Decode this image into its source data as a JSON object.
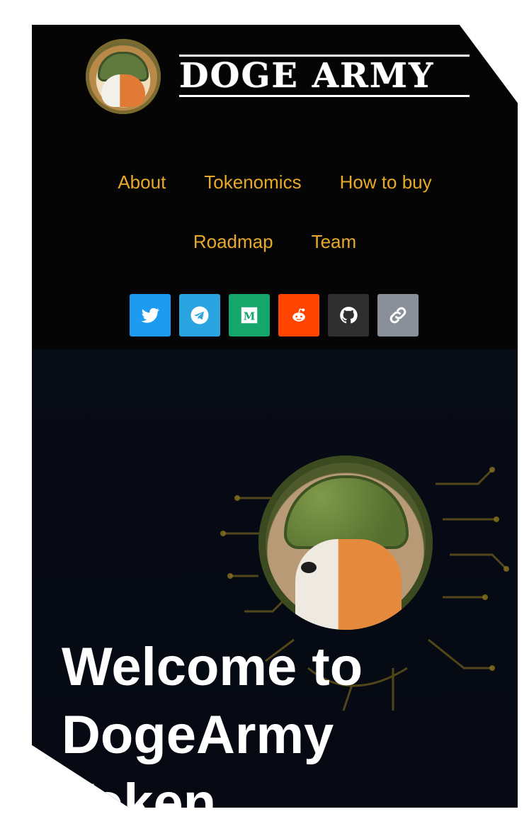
{
  "brand": {
    "logo_text": "DOGE ARMY"
  },
  "nav": {
    "items": [
      {
        "label": "About"
      },
      {
        "label": "Tokenomics"
      },
      {
        "label": "How to buy"
      },
      {
        "label": "Roadmap"
      },
      {
        "label": "Team"
      }
    ]
  },
  "socials": [
    {
      "icon": "twitter-icon",
      "color": "#1d9bf0"
    },
    {
      "icon": "telegram-icon",
      "color": "#2aa4e0"
    },
    {
      "icon": "medium-icon",
      "color": "#14a66b"
    },
    {
      "icon": "reddit-icon",
      "color": "#ff4500"
    },
    {
      "icon": "github-icon",
      "color": "#2f2f2f"
    },
    {
      "icon": "link-icon",
      "color": "#8a9099"
    }
  ],
  "hero": {
    "headline_line1": "Welcome to",
    "headline_line2": "DogeArmy",
    "headline_line3": "Token"
  },
  "theme": {
    "accent": "#e8a92a",
    "header_bg": "#050505",
    "hero_bg": "#070b16"
  }
}
